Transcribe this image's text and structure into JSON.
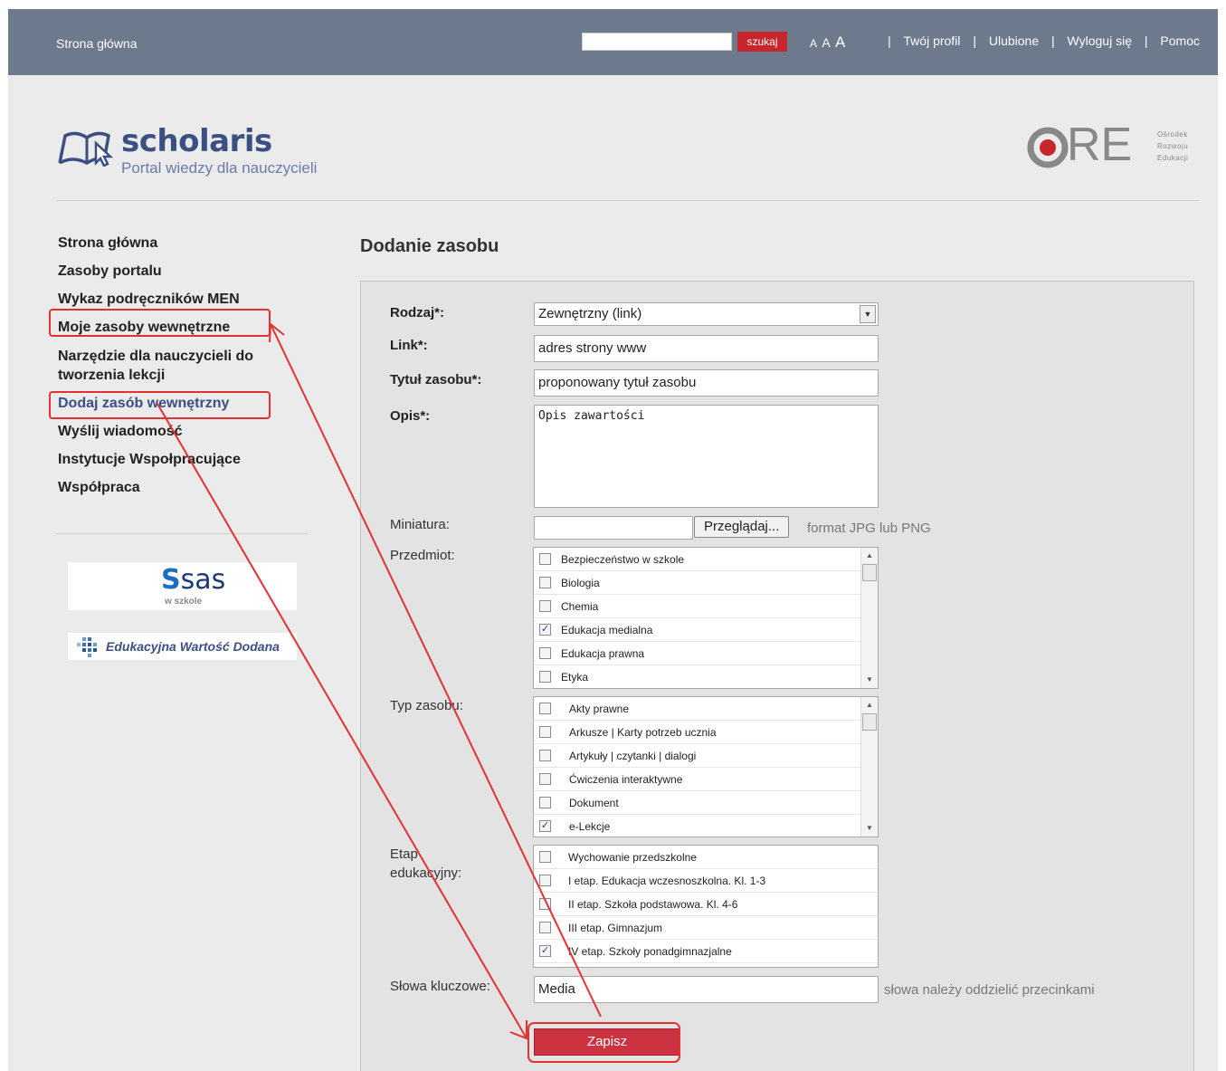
{
  "topbar": {
    "home": "Strona główna",
    "search_placeholder": "",
    "search_button": "szukaj",
    "font_sizes": [
      "A",
      "A",
      "A"
    ],
    "links": [
      "Twój profil",
      "Ulubione",
      "Wyloguj się",
      "Pomoc"
    ],
    "separator": "|"
  },
  "header": {
    "logo_name": "scholaris",
    "logo_tagline": "Portal wiedzy dla nauczycieli",
    "partner_logo_letters": "RE",
    "partner_logo_sub": [
      "Ośrodek",
      "Rozwoju",
      "Edukacji"
    ]
  },
  "sidebar": {
    "items": [
      {
        "label": "Strona główna"
      },
      {
        "label": "Zasoby portalu"
      },
      {
        "label": "Wykaz podręczników MEN"
      },
      {
        "label": "Moje zasoby wewnętrzne"
      },
      {
        "label": "Narzędzie dla nauczycieli do tworzenia lekcji"
      },
      {
        "label": "Dodaj zasób wewnętrzny"
      },
      {
        "label": "Wyślij wiadomość"
      },
      {
        "label": "Instytucje Wspołpracujące"
      },
      {
        "label": "Współpraca"
      }
    ],
    "sas_logo": "sas",
    "sas_sub": "w szkole",
    "ewd_logo": "Edukacyjna Wartość Dodana"
  },
  "main": {
    "title": "Dodanie zasobu",
    "form": {
      "rodzaj_label": "Rodzaj*:",
      "rodzaj_value": "Zewnętrzny (link)",
      "link_label": "Link*:",
      "link_value": "adres strony www",
      "tytul_label": "Tytuł zasobu*:",
      "tytul_value": "proponowany tytuł zasobu",
      "opis_label": "Opis*:",
      "opis_value": "Opis zawartości",
      "miniatura_label": "Miniatura:",
      "browse_button": "Przeglądaj...",
      "miniatura_hint": "format JPG lub PNG",
      "przedmiot_label": "Przedmiot:",
      "przedmiot_items": [
        {
          "label": "Bezpieczeństwo w szkole",
          "checked": false
        },
        {
          "label": "Biologia",
          "checked": false
        },
        {
          "label": "Chemia",
          "checked": false
        },
        {
          "label": "Edukacja medialna",
          "checked": true
        },
        {
          "label": "Edukacja prawna",
          "checked": false
        },
        {
          "label": "Etyka",
          "checked": false
        }
      ],
      "typ_label": "Typ zasobu:",
      "typ_items": [
        {
          "label": "Akty prawne",
          "checked": false
        },
        {
          "label": "Arkusze | Karty potrzeb ucznia",
          "checked": false
        },
        {
          "label": "Artykuły | czytanki | dialogi",
          "checked": false
        },
        {
          "label": "Ćwiczenia interaktywne",
          "checked": false
        },
        {
          "label": "Dokument",
          "checked": false
        },
        {
          "label": "e-Lekcje",
          "checked": true
        }
      ],
      "etap_label_1": "Etap",
      "etap_label_2": "edukacyjny:",
      "etap_items": [
        {
          "label": "Wychowanie przedszkolne",
          "checked": false
        },
        {
          "label": "I etap. Edukacja wczesnoszkolna. Kl. 1-3",
          "checked": false
        },
        {
          "label": "II etap. Szkoła podstawowa. Kl. 4-6",
          "checked": false
        },
        {
          "label": "III etap. Gimnazjum",
          "checked": false
        },
        {
          "label": "IV etap. Szkoły ponadgimnazjalne",
          "checked": true
        }
      ],
      "slowa_label": "Słowa kluczowe:",
      "slowa_value": "Media",
      "slowa_hint": "słowa należy oddzielić przecinkami",
      "save_button": "Zapisz"
    }
  },
  "colors": {
    "topbar": "#6d7a8d",
    "accent_red": "#cc3240",
    "annotation": "#e23232",
    "logo_blue": "#3b4f83"
  }
}
